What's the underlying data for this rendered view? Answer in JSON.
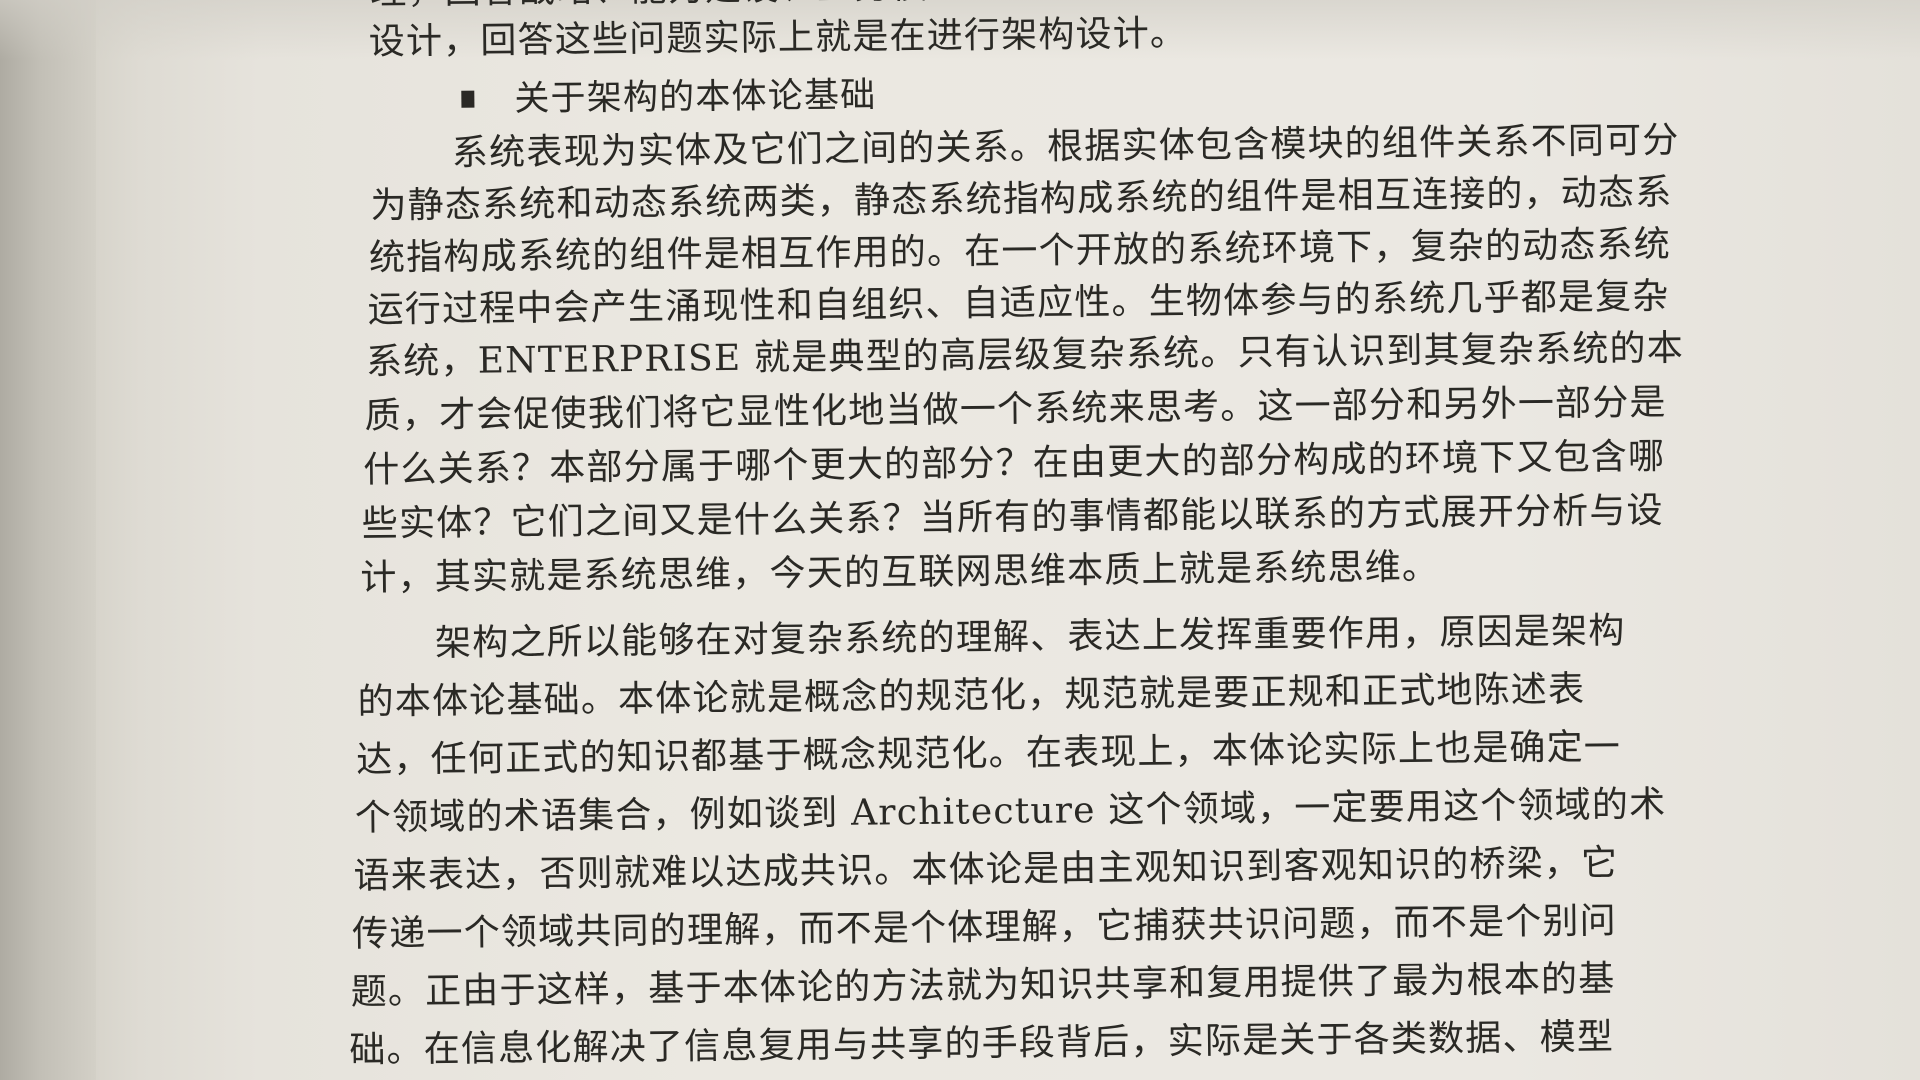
{
  "page": {
    "section_heading": "关于架构的本体论基础",
    "lines": [
      "理，回答战略、能力建设、业务模型的对准问题，也就是目前广泛进行的变革",
      "设计，回答这些问题实际上就是在进行架构设计。",
      "系统表现为实体及它们之间的关系。根据实体包含模块的组件关系不同可分",
      "为静态系统和动态系统两类，静态系统指构成系统的组件是相互连接的，动态系",
      "统指构成系统的组件是相互作用的。在一个开放的系统环境下，复杂的动态系统",
      "运行过程中会产生涌现性和自组织、自适应性。生物体参与的系统几乎都是复杂",
      "系统，ENTERPRISE 就是典型的高层级复杂系统。只有认识到其复杂系统的本",
      "质，才会促使我们将它显性化地当做一个系统来思考。这一部分和另外一部分是",
      "什么关系？本部分属于哪个更大的部分？在由更大的部分构成的环境下又包含哪",
      "些实体？它们之间又是什么关系？当所有的事情都能以联系的方式展开分析与设",
      "计，其实就是系统思维，今天的互联网思维本质上就是系统思维。",
      "架构之所以能够在对复杂系统的理解、表达上发挥重要作用，原因是架构",
      "的本体论基础。本体论就是概念的规范化，规范就是要正规和正式地陈述表",
      "达，任何正式的知识都基于概念规范化。在表现上，本体论实际上也是确定一",
      "个领域的术语集合，例如谈到 Architecture 这个领域，一定要用这个领域的术",
      "语来表达，否则就难以达成共识。本体论是由主观知识到客观知识的桥梁，它",
      "传递一个领域共同的理解，而不是个体理解，它捕获共识问题，而不是个别问",
      "题。正由于这样，基于本体论的方法就为知识共享和复用提供了最为根本的基",
      "础。在信息化解决了信息复用与共享的手段背后，实际是关于各类数据、模型"
    ]
  }
}
